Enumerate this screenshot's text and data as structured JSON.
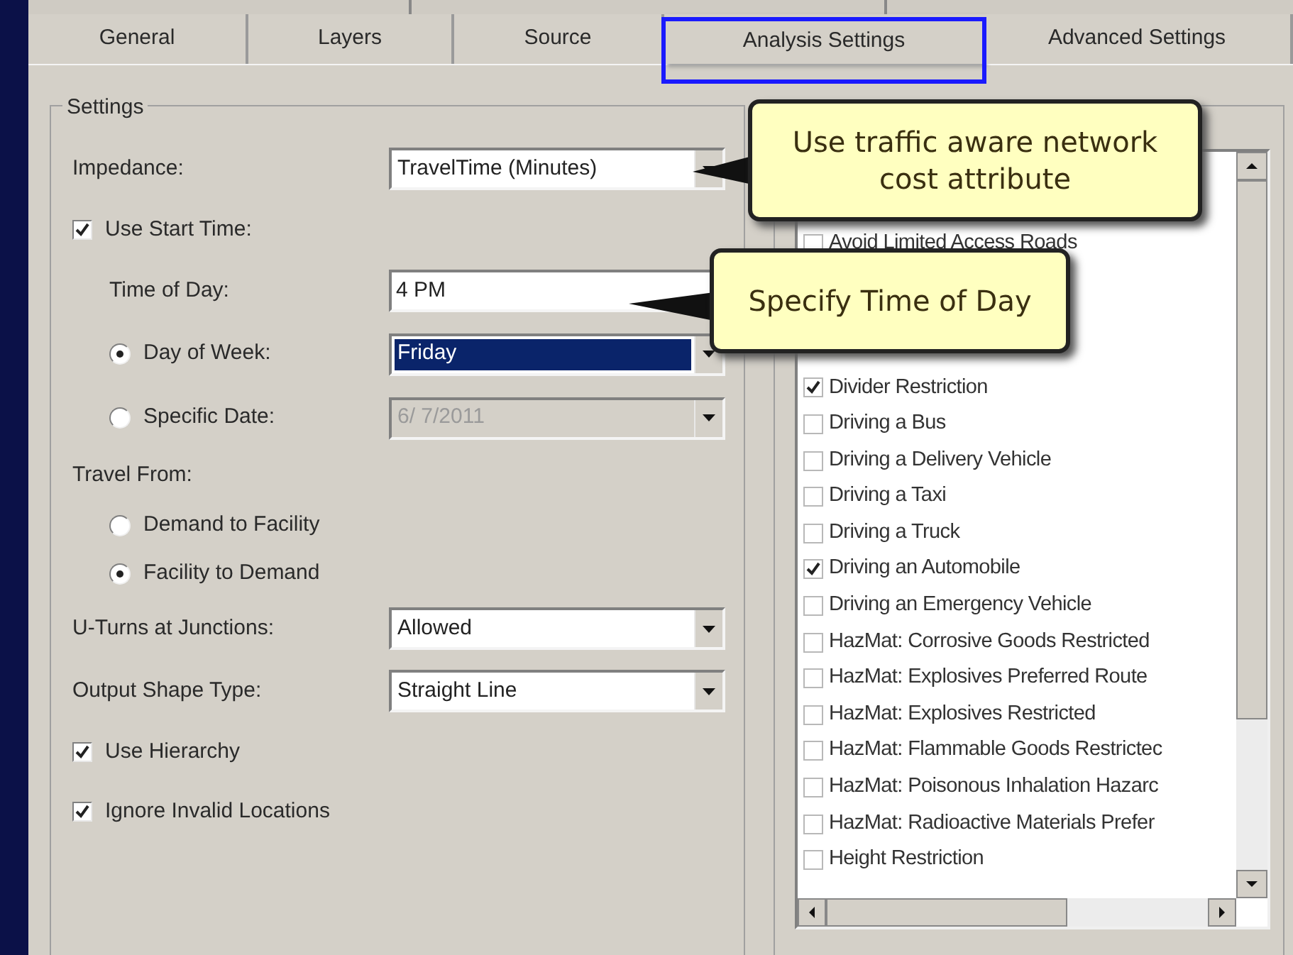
{
  "tabs": [
    {
      "label": "General",
      "selected": false,
      "highlighted": false
    },
    {
      "label": "Layers",
      "selected": false,
      "highlighted": false
    },
    {
      "label": "Source",
      "selected": false,
      "highlighted": false
    },
    {
      "label": "Analysis Settings",
      "selected": true,
      "highlighted": true
    },
    {
      "label": "Advanced Settings",
      "selected": false,
      "highlighted": false
    }
  ],
  "settings": {
    "title": "Settings",
    "fields": [
      {
        "kind": "dropdown",
        "label": "Impedance:",
        "value": "TravelTime (Minutes)"
      },
      {
        "kind": "checkbox",
        "label": "Use Start Time:",
        "checked": true,
        "children": [
          {
            "kind": "text",
            "label": "Time of Day:",
            "value": "4 PM"
          },
          {
            "kind": "radio",
            "label": "Day of Week:",
            "selected": true,
            "control": {
              "value": "Friday",
              "highlighted": true,
              "disabled": false
            }
          },
          {
            "kind": "radio",
            "label": "Specific Date:",
            "selected": false,
            "control": {
              "value": "6/  7/2011",
              "highlighted": false,
              "disabled": true
            }
          }
        ]
      },
      {
        "kind": "label",
        "label": "Travel From:",
        "children": [
          {
            "kind": "radio",
            "label": "Demand to Facility",
            "selected": false
          },
          {
            "kind": "radio",
            "label": "Facility to Demand",
            "selected": true
          }
        ]
      },
      {
        "kind": "dropdown",
        "label": "U-Turns at Junctions:",
        "value": "Allowed"
      },
      {
        "kind": "dropdown",
        "label": "Output Shape Type:",
        "value": "Straight Line"
      },
      {
        "kind": "checkbox",
        "label": "Use Hierarchy",
        "checked": true
      },
      {
        "kind": "checkbox",
        "label": "Ignore Invalid Locations",
        "checked": true
      }
    ]
  },
  "restrictions": {
    "items": [
      {
        "label": "Avoid Limited Access Roads",
        "checked": false
      },
      {
        "label": "Divider Restriction",
        "checked": true
      },
      {
        "label": "Driving a Bus",
        "checked": false
      },
      {
        "label": "Driving a Delivery Vehicle",
        "checked": false
      },
      {
        "label": "Driving a Taxi",
        "checked": false
      },
      {
        "label": "Driving a Truck",
        "checked": false
      },
      {
        "label": "Driving an Automobile",
        "checked": true
      },
      {
        "label": "Driving an Emergency Vehicle",
        "checked": false
      },
      {
        "label": "HazMat: Corrosive Goods Restricted",
        "checked": false
      },
      {
        "label": "HazMat: Explosives Preferred Route",
        "checked": false
      },
      {
        "label": "HazMat: Explosives Restricted",
        "checked": false
      },
      {
        "label": "HazMat: Flammable Goods Restrictec",
        "checked": false
      },
      {
        "label": "HazMat: Poisonous Inhalation Hazarc",
        "checked": false
      },
      {
        "label": "HazMat: Radioactive Materials Prefer",
        "checked": false
      },
      {
        "label": "Height Restriction",
        "checked": false
      }
    ]
  },
  "callouts": [
    {
      "text": "Use traffic aware network cost attribute"
    },
    {
      "text": "Specify Time of Day"
    }
  ]
}
